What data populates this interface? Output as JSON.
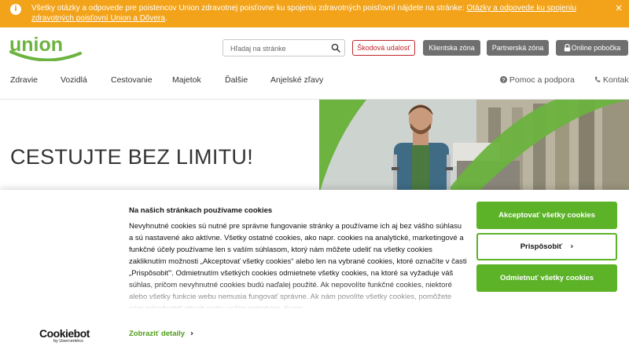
{
  "notice": {
    "icon": "info-icon",
    "text": "Všetky otázky a odpovede pre poistencov Union zdravotnej poisťovne ku spojeniu zdravotných poisťovní nájdete na stránke: ",
    "link": "Otázky a odpovede ku spojeniu zdravotných poisťovní Union a Dôvera",
    "suffix": ".",
    "close_icon": "close-icon",
    "background": "#f2a31a"
  },
  "header": {
    "logo_text": "union",
    "search": {
      "placeholder": "Hľadaj na stránke",
      "value": "",
      "icon": "search-icon"
    },
    "claim_button": "Škodová udalosť",
    "client_zone_button": "Klientska zóna",
    "partner_zone_button": "Partnerská zóna",
    "online_branch_button": "Online pobočka",
    "online_branch_icon": "lock-icon"
  },
  "nav": {
    "items": [
      "Zdravie",
      "Vozidlá",
      "Cestovanie",
      "Majetok",
      "Ďalšie",
      "Anjelské zľavy"
    ],
    "help": {
      "icon": "help-icon",
      "label": "Pomoc a podpora"
    },
    "contact": {
      "icon": "phone-icon",
      "label": "Kontakt"
    }
  },
  "hero": {
    "title": "CESTUJTE BEZ LIMITU!"
  },
  "cookie": {
    "title": "Na našich stránkach používame cookies",
    "body": "Nevyhnutné cookies sú nutné pre správne fungovanie stránky a používame ich aj bez vášho súhlasu a sú nastavené ako aktívne. Všetky ostatné cookies, ako napr. cookies na analytické, marketingové a funkčné účely používame len s vaším súhlasom, ktorý nám môžete udeliť na všetky cookies zakliknutím možnosti „Akceptovať všetky cookies“ alebo len na vybrané cookies, ktoré označíte v časti „Prispôsobiť“. Odmietnutím všetkých cookies odmietnete všetky cookies, na ktoré sa vyžaduje váš súhlas, pričom nevyhnutné cookies budú naďalej použité. Ak nepovolíte funkčné cookies, niektoré alebo všetky funkcie webu nemusia fungovať správne. Ak nám povolíte všetky cookies, pomôžete nám prispôsobiť obsah webu vašim potrebám. Svoje",
    "details_link": "Zobraziť detaily",
    "accept_button": "Akceptovať všetky cookies",
    "customize_button": "Prispôsobiť",
    "reject_button": "Odmietnuť všetky cookies",
    "provider_logo": "Cookiebot",
    "provider_sub": "by Usercentrics"
  },
  "colors": {
    "brand_green": "#6cb33f",
    "cookie_green": "#5cb328",
    "claim_red": "#c0272d",
    "gray_button": "#6f6f6f",
    "notice_orange": "#f2a31a"
  }
}
